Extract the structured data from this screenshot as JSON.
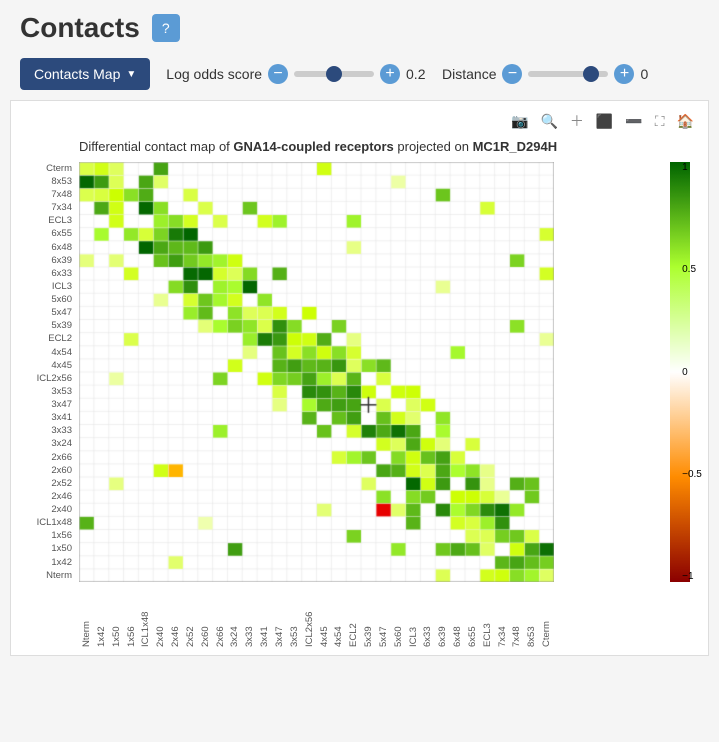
{
  "header": {
    "title": "Contacts",
    "help_label": "?"
  },
  "toolbar": {
    "contacts_map_label": "Contacts Map",
    "log_odds_score_label": "Log odds score",
    "log_odds_minus": "−",
    "log_odds_plus": "+",
    "log_odds_value": "0.2",
    "log_odds_thumb_pct": 45,
    "distance_label": "Distance",
    "distance_minus": "−",
    "distance_plus": "+",
    "distance_value": "0",
    "distance_thumb_pct": 75
  },
  "chart": {
    "toolbar_icons": [
      "camera",
      "zoom",
      "zoom-in",
      "expand-y",
      "collapse-y",
      "fullscreen",
      "home"
    ],
    "title_prefix": "Differential contact map of ",
    "protein1": "GNA14-coupled receptors",
    "title_middle": " projected on ",
    "protein2": "MC1R_D294H"
  },
  "y_labels": [
    "Cterm",
    "8x53",
    "7x48",
    "7x34",
    "ECL3",
    "6x55",
    "6x48",
    "6x39",
    "6x33",
    "ICL3",
    "5x60",
    "5x47",
    "5x39",
    "ECL2",
    "4x54",
    "4x45",
    "ICL2x56",
    "3x53",
    "3x47",
    "3x41",
    "3x33",
    "3x24",
    "2x66",
    "2x60",
    "2x52",
    "2x46",
    "2x40",
    "ICL1x48",
    "1x56",
    "1x50",
    "1x42",
    "Nterm"
  ],
  "x_labels": [
    "Nterm",
    "1x42",
    "1x50",
    "1x56",
    "ICL1x48",
    "2x40",
    "2x46",
    "2x52",
    "2x60",
    "2x66",
    "3x24",
    "3x33",
    "3x41",
    "3x47",
    "3x53",
    "ICL2x56",
    "4x45",
    "4x54",
    "ECL2",
    "5x39",
    "5x47",
    "5x60",
    "ICL3",
    "6x33",
    "6x39",
    "6x48",
    "6x55",
    "ECL3",
    "7x34",
    "7x48",
    "8x53",
    "Cterm"
  ],
  "colorbar": {
    "ticks": [
      "1",
      "0.5",
      "0",
      "-0.5",
      "-1"
    ]
  },
  "colors": {
    "dark_green": "#006400",
    "light_green": "#adff2f",
    "white": "#ffffff",
    "light_red": "#ff8c00",
    "dark_red": "#8b0000"
  }
}
